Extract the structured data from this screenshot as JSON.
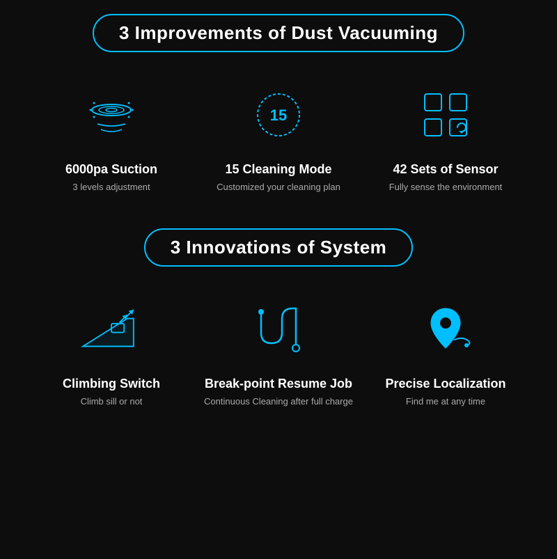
{
  "section1": {
    "badge": "3 Improvements of Dust Vacuuming",
    "features": [
      {
        "title": "6000pa Suction",
        "subtitle": "3 levels adjustment",
        "icon": "suction"
      },
      {
        "title": "15 Cleaning Mode",
        "subtitle": "Customized your cleaning plan",
        "icon": "mode"
      },
      {
        "title": "42 Sets of Sensor",
        "subtitle": "Fully sense the environment",
        "icon": "sensor"
      }
    ]
  },
  "section2": {
    "badge": "3 Innovations of System",
    "features": [
      {
        "title": "Climbing Switch",
        "subtitle": "Climb sill or not",
        "icon": "climbing"
      },
      {
        "title": "Break-point Resume Job",
        "subtitle": "Continuous Cleaning after full charge",
        "icon": "resume"
      },
      {
        "title": "Precise Localization",
        "subtitle": "Find me at any time",
        "icon": "location"
      }
    ]
  }
}
